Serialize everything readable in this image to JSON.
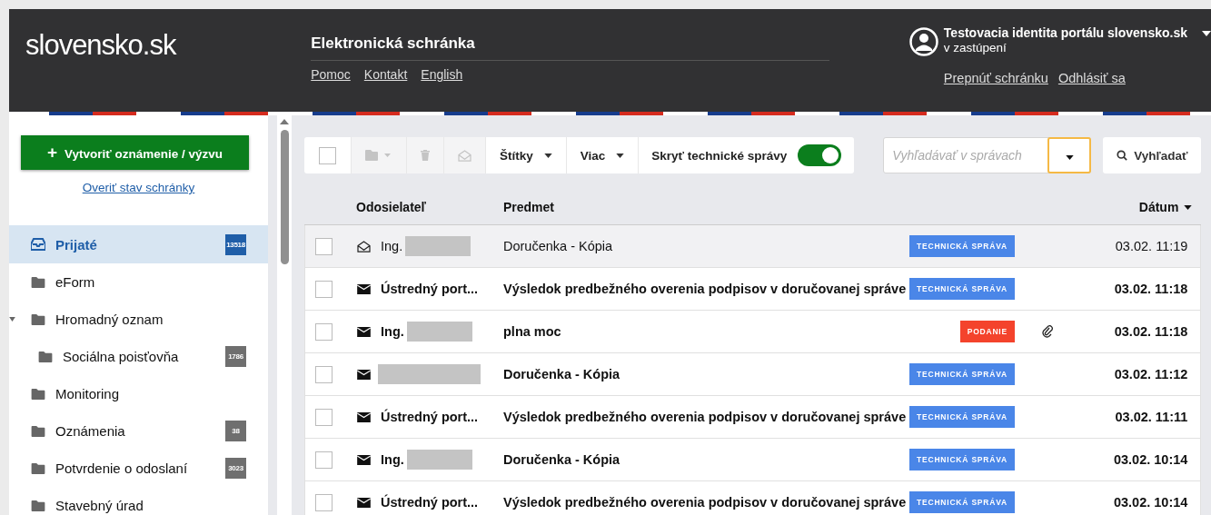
{
  "header": {
    "logo": "slovensko.sk",
    "title": "Elektronická schránka",
    "links": [
      "Pomoc",
      "Kontakt",
      "English"
    ],
    "user": {
      "name": "Testovacia identita portálu slovensko.sk",
      "role": "v zastúpení"
    },
    "user_links": [
      "Prepnúť schránku",
      "Odhlásiť sa"
    ]
  },
  "sidebar": {
    "create_icon": "+",
    "create_button": "Vytvoriť oznámenie / výzvu",
    "check_link": "Overiť stav schránky",
    "items": [
      {
        "label": "Prijaté",
        "kind": "inbox",
        "selected": true,
        "badge": "13518"
      },
      {
        "label": "eForm",
        "kind": "folder",
        "selected": false
      },
      {
        "label": "Hromadný oznam",
        "kind": "folder",
        "selected": false,
        "expanded": true,
        "children": [
          {
            "label": "Sociálna poisťovňa",
            "kind": "folder",
            "selected": false,
            "badge": "1786"
          }
        ]
      },
      {
        "label": "Monitoring",
        "kind": "folder",
        "selected": false
      },
      {
        "label": "Oznámenia",
        "kind": "folder",
        "selected": false,
        "badge": "38"
      },
      {
        "label": "Potvrdenie o odoslaní",
        "kind": "folder",
        "selected": false,
        "badge": "3023"
      },
      {
        "label": "Stavebný úrad",
        "kind": "folder",
        "selected": false
      }
    ]
  },
  "toolbar": {
    "select_all": {
      "checked": false
    },
    "labels_button": "Štítky",
    "more_button": "Viac",
    "hide_technical": {
      "label": "Skryť technické správy",
      "on": true
    },
    "search": {
      "placeholder": "Vyhľadávať v správach"
    },
    "search_button": "Vyhľadať"
  },
  "table": {
    "columns": [
      "Odosielateľ",
      "Predmet",
      "Dátum"
    ],
    "rows": [
      {
        "checked": false,
        "unread": false,
        "sender": "Ing.",
        "redacted": true,
        "subject": "Doručenka - Kópia",
        "tag": {
          "text": "TECHNICKÁ SPRÁVA",
          "color": "#4a86e8"
        },
        "attachment": false,
        "date": "03.02. 11:19"
      },
      {
        "checked": false,
        "unread": true,
        "sender": "Ústredný port...",
        "redacted": false,
        "subject": "Výsledok predbežného overenia podpisov v doručovanej správe",
        "tag": {
          "text": "TECHNICKÁ SPRÁVA",
          "color": "#4a86e8"
        },
        "attachment": false,
        "date": "03.02. 11:18"
      },
      {
        "checked": false,
        "unread": true,
        "sender": "Ing.",
        "redacted": true,
        "subject": "plna moc",
        "tag": {
          "text": "PODANIE",
          "color": "#f4432c"
        },
        "attachment": true,
        "date": "03.02. 11:18"
      },
      {
        "checked": false,
        "unread": true,
        "redacted": true,
        "subject": "Doručenka - Kópia",
        "tag": {
          "text": "TECHNICKÁ SPRÁVA",
          "color": "#4a86e8"
        },
        "attachment": false,
        "date": "03.02. 11:12"
      },
      {
        "checked": false,
        "unread": true,
        "sender": "Ústredný port...",
        "redacted": false,
        "subject": "Výsledok predbežného overenia podpisov v doručovanej správe",
        "tag": {
          "text": "TECHNICKÁ SPRÁVA",
          "color": "#4a86e8"
        },
        "attachment": false,
        "date": "03.02. 11:11"
      },
      {
        "checked": false,
        "unread": true,
        "sender": "Ing.",
        "redacted": true,
        "subject": "Doručenka - Kópia",
        "tag": {
          "text": "TECHNICKÁ SPRÁVA",
          "color": "#4a86e8"
        },
        "attachment": false,
        "date": "03.02. 10:14"
      },
      {
        "checked": false,
        "unread": true,
        "sender": "Ústredný port...",
        "redacted": false,
        "subject": "Výsledok predbežného overenia podpisov v doručovanej správe",
        "tag": {
          "text": "TECHNICKÁ SPRÁVA",
          "color": "#4a86e8"
        },
        "attachment": false,
        "date": "03.02. 10:14"
      }
    ]
  }
}
